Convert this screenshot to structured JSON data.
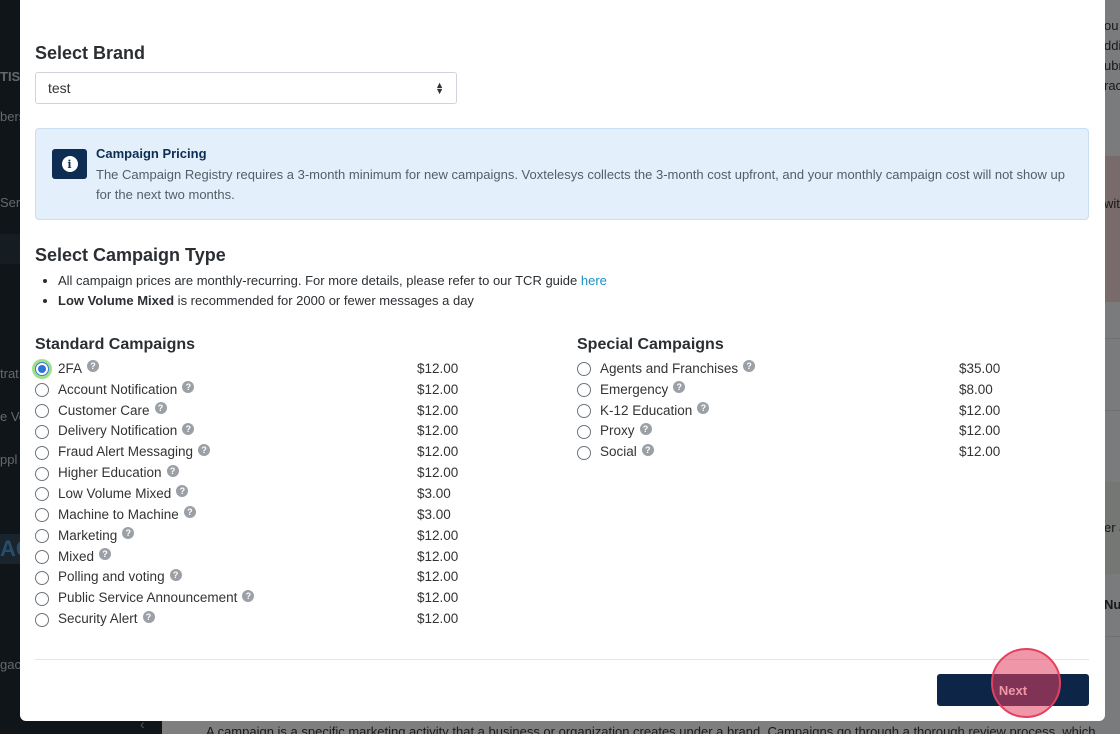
{
  "background": {
    "sidebar_fragments": [
      "TISI",
      "bers",
      "Serv",
      "trat",
      "e Ve",
      "ppl",
      "gac"
    ],
    "sidebar_big": "AC",
    "sidebar_collapse_icon": "chevron-left-icon",
    "right_fragments": [
      "ou",
      "ddi",
      "ubr",
      "rac",
      "wit",
      "er a",
      "Nur"
    ],
    "bottom_text": "A campaign is a specific marketing activity that a business or organization creates under a brand. Campaigns go through a thorough review process, which"
  },
  "modal": {
    "brand_title": "Select Brand",
    "brand_value": "test",
    "alert": {
      "icon": "info-icon",
      "title": "Campaign Pricing",
      "body": "The Campaign Registry requires a 3-month minimum for new campaigns. Voxtelesys collects the 3-month cost upfront, and your monthly campaign cost will not show up for the next two months."
    },
    "type_title": "Select Campaign Type",
    "notes": {
      "line1_text": "All campaign prices are monthly-recurring. For more details, please refer to our TCR guide ",
      "line1_link": "here",
      "line2_bold": "Low Volume Mixed",
      "line2_text": " is recommended for 2000 or fewer messages a day"
    },
    "standard": {
      "title": "Standard Campaigns",
      "items": [
        {
          "label": "2FA",
          "price": "$12.00",
          "checked": true
        },
        {
          "label": "Account Notification",
          "price": "$12.00"
        },
        {
          "label": "Customer Care",
          "price": "$12.00"
        },
        {
          "label": "Delivery Notification",
          "price": "$12.00"
        },
        {
          "label": "Fraud Alert Messaging",
          "price": "$12.00"
        },
        {
          "label": "Higher Education",
          "price": "$12.00"
        },
        {
          "label": "Low Volume Mixed",
          "price": "$3.00"
        },
        {
          "label": "Machine to Machine",
          "price": "$3.00"
        },
        {
          "label": "Marketing",
          "price": "$12.00"
        },
        {
          "label": "Mixed",
          "price": "$12.00"
        },
        {
          "label": "Polling and voting",
          "price": "$12.00"
        },
        {
          "label": "Public Service Announcement",
          "price": "$12.00"
        },
        {
          "label": "Security Alert",
          "price": "$12.00"
        }
      ]
    },
    "special": {
      "title": "Special Campaigns",
      "items": [
        {
          "label": "Agents and Franchises",
          "price": "$35.00"
        },
        {
          "label": "Emergency",
          "price": "$8.00"
        },
        {
          "label": "K-12 Education",
          "price": "$12.00"
        },
        {
          "label": "Proxy",
          "price": "$12.00"
        },
        {
          "label": "Social",
          "price": "$12.00"
        }
      ]
    },
    "help_icon": "question-circle-icon",
    "next_label": "Next"
  },
  "colors": {
    "primary": "#0d2547",
    "alert_bg": "#e3f0fb",
    "link": "#1f8fc8",
    "click_marker": "#e3405f"
  }
}
